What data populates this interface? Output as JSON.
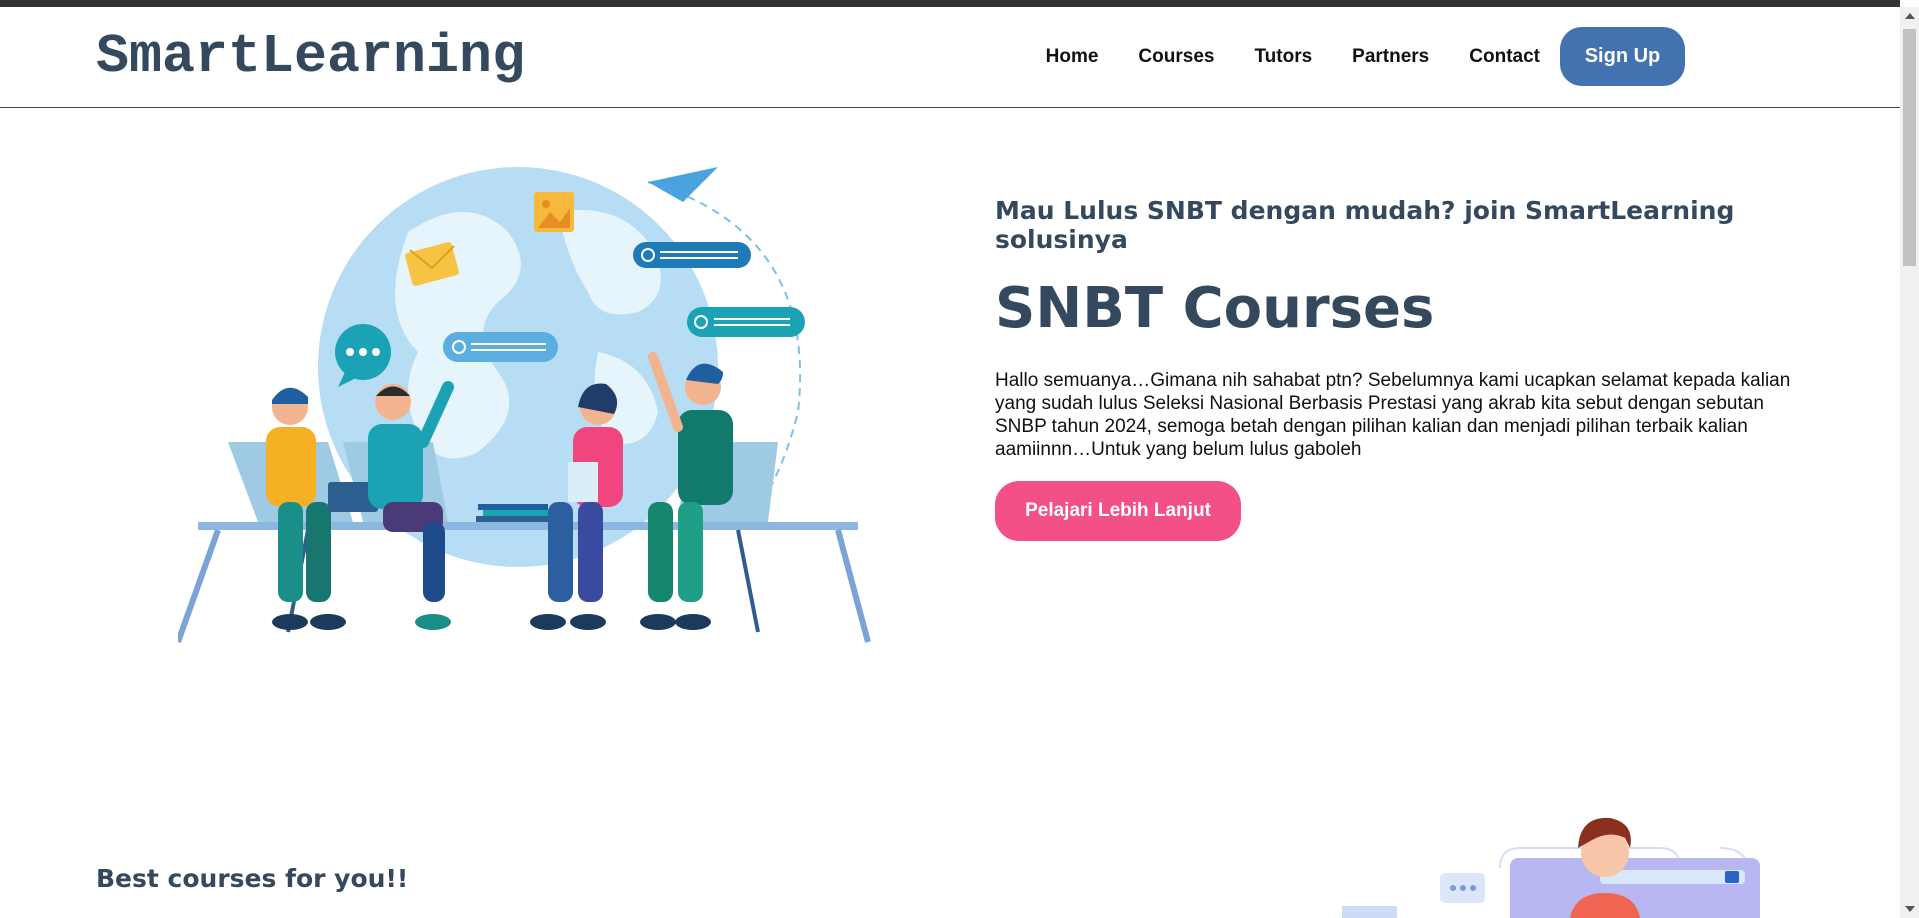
{
  "brand": "SmartLearning",
  "nav": {
    "items": [
      "Home",
      "Courses",
      "Tutors",
      "Partners",
      "Contact"
    ],
    "signup_label": "Sign Up"
  },
  "hero": {
    "subtitle": "Mau Lulus SNBT dengan mudah? join SmartLearning solusinya",
    "title": "SNBT Courses",
    "description": "Hallo semuanya…Gimana nih sahabat ptn? Sebelumnya kami ucapkan selamat kepada kalian yang sudah lulus Seleksi Nasional Berbasis Prestasi yang akrab kita sebut dengan sebutan SNBP tahun 2024, semoga betah dengan pilihan kalian dan menjadi pilihan terbaik kalian aamiinnn…Untuk yang belum lulus gaboleh",
    "cta_label": "Pelajari Lebih Lanjut"
  },
  "section": {
    "heading": "Best courses for you!!"
  },
  "colors": {
    "brand": "#34495e",
    "signup": "#4272b0",
    "cta": "#f34f89"
  }
}
